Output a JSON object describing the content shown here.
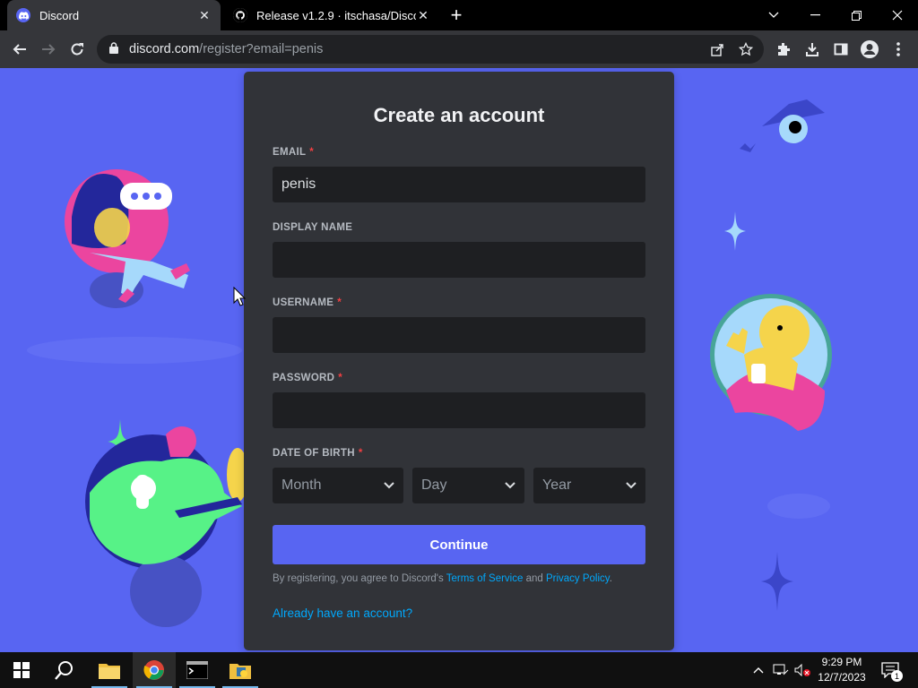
{
  "browser": {
    "tabs": [
      {
        "title": "Discord",
        "close_label": "✕"
      },
      {
        "title": "Release v1.2.9 · itschasa/Discord",
        "close_label": "✕"
      }
    ],
    "new_tab_label": "+",
    "url_host": "discord.com",
    "url_path": "/register?email=penis",
    "icons": [
      "back-icon",
      "forward-icon",
      "reload-icon",
      "lock-icon",
      "share-icon",
      "star-icon",
      "extensions-icon",
      "download-icon",
      "side-panel-icon",
      "profile-icon",
      "menu-icon"
    ]
  },
  "form": {
    "title": "Create an account",
    "email_label": "EMAIL",
    "email_value": "penis",
    "display_name_label": "DISPLAY NAME",
    "display_name_value": "",
    "username_label": "USERNAME",
    "username_value": "",
    "password_label": "PASSWORD",
    "password_value": "",
    "dob_label": "DATE OF BIRTH",
    "required_mark": "*",
    "month_placeholder": "Month",
    "day_placeholder": "Day",
    "year_placeholder": "Year",
    "continue_label": "Continue",
    "legal_prefix": "By registering, you agree to Discord's ",
    "tos_link": "Terms of Service",
    "legal_and": " and ",
    "privacy_link": "Privacy Policy",
    "legal_suffix": ".",
    "login_link": "Already have an account?"
  },
  "taskbar": {
    "time": "9:29 PM",
    "date": "12/7/2023",
    "notification_count": "1",
    "apps": [
      "start-icon",
      "search-icon",
      "file-explorer-icon",
      "chrome-icon",
      "terminal-icon",
      "app-icon"
    ]
  },
  "colors": {
    "page_bg": "#5865f2",
    "card_bg": "#313338",
    "input_bg": "#1e1f22",
    "link": "#00a8fc",
    "required": "#f23f42"
  }
}
